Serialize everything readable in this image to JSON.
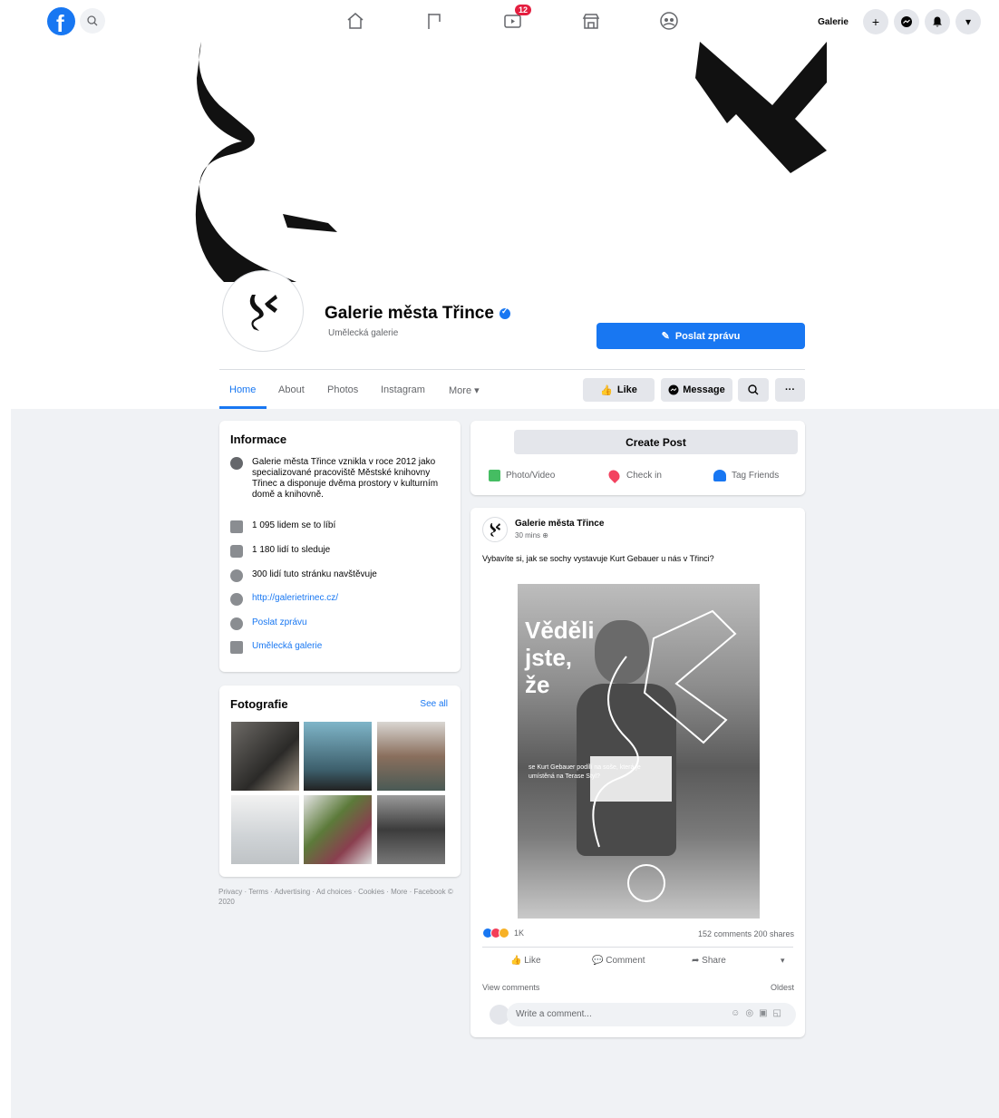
{
  "nav": {
    "logo": "f",
    "profile_name": "Galerie",
    "video_badge": "12",
    "plus": "+",
    "caret": "▾"
  },
  "page": {
    "name": "Galerie města Třince",
    "category": "Umělecká galerie",
    "message_button": "Poslat zprávu"
  },
  "tabs": {
    "home": "Home",
    "about": "About",
    "photos": "Photos",
    "instagram": "Instagram",
    "more": "More ▾"
  },
  "actions": {
    "like": "Like",
    "message": "Message",
    "more": "···"
  },
  "info": {
    "title": "Informace",
    "description": "Galerie města Třince vznikla v roce 2012 jako specializované pracoviště Městské knihovny Třinec a disponuje dvěma prostory v kulturním domě a knihovně.",
    "likes": "1 095 lidem se to líbí",
    "follows": "1 180 lidí to sleduje",
    "visits": "300 lidí tuto stránku navštěvuje",
    "website": "http://galerietrinec.cz/",
    "message": "Poslat zprávu",
    "category": "Umělecká galerie"
  },
  "photos": {
    "title": "Fotografie",
    "see_all": "See all"
  },
  "footer": "Privacy · Terms · Advertising · Ad choices · Cookies · More · Facebook © 2020",
  "composer": {
    "create_post": "Create Post",
    "photo_video": "Photo/Video",
    "check_in": "Check in",
    "tag_friends": "Tag Friends"
  },
  "post": {
    "author": "Galerie města Třince",
    "time": "30 mins",
    "text": "Vybavíte si, jak se sochy vystavuje Kurt Gebauer u nás v Třinci?",
    "poster_title_line1": "Věděli",
    "poster_title_line2": "jste,",
    "poster_title_line3": "že",
    "poster_body": "se Kurt Gebauer podílí na soše, která je umístěná na Terase Styl?",
    "reaction_count": "1K",
    "comments_shares": "152 comments  200 shares",
    "like": "Like",
    "comment": "Comment",
    "share": "Share",
    "view_comments": "View comments",
    "oldest": "Oldest",
    "comment_placeholder": "Write a comment..."
  }
}
